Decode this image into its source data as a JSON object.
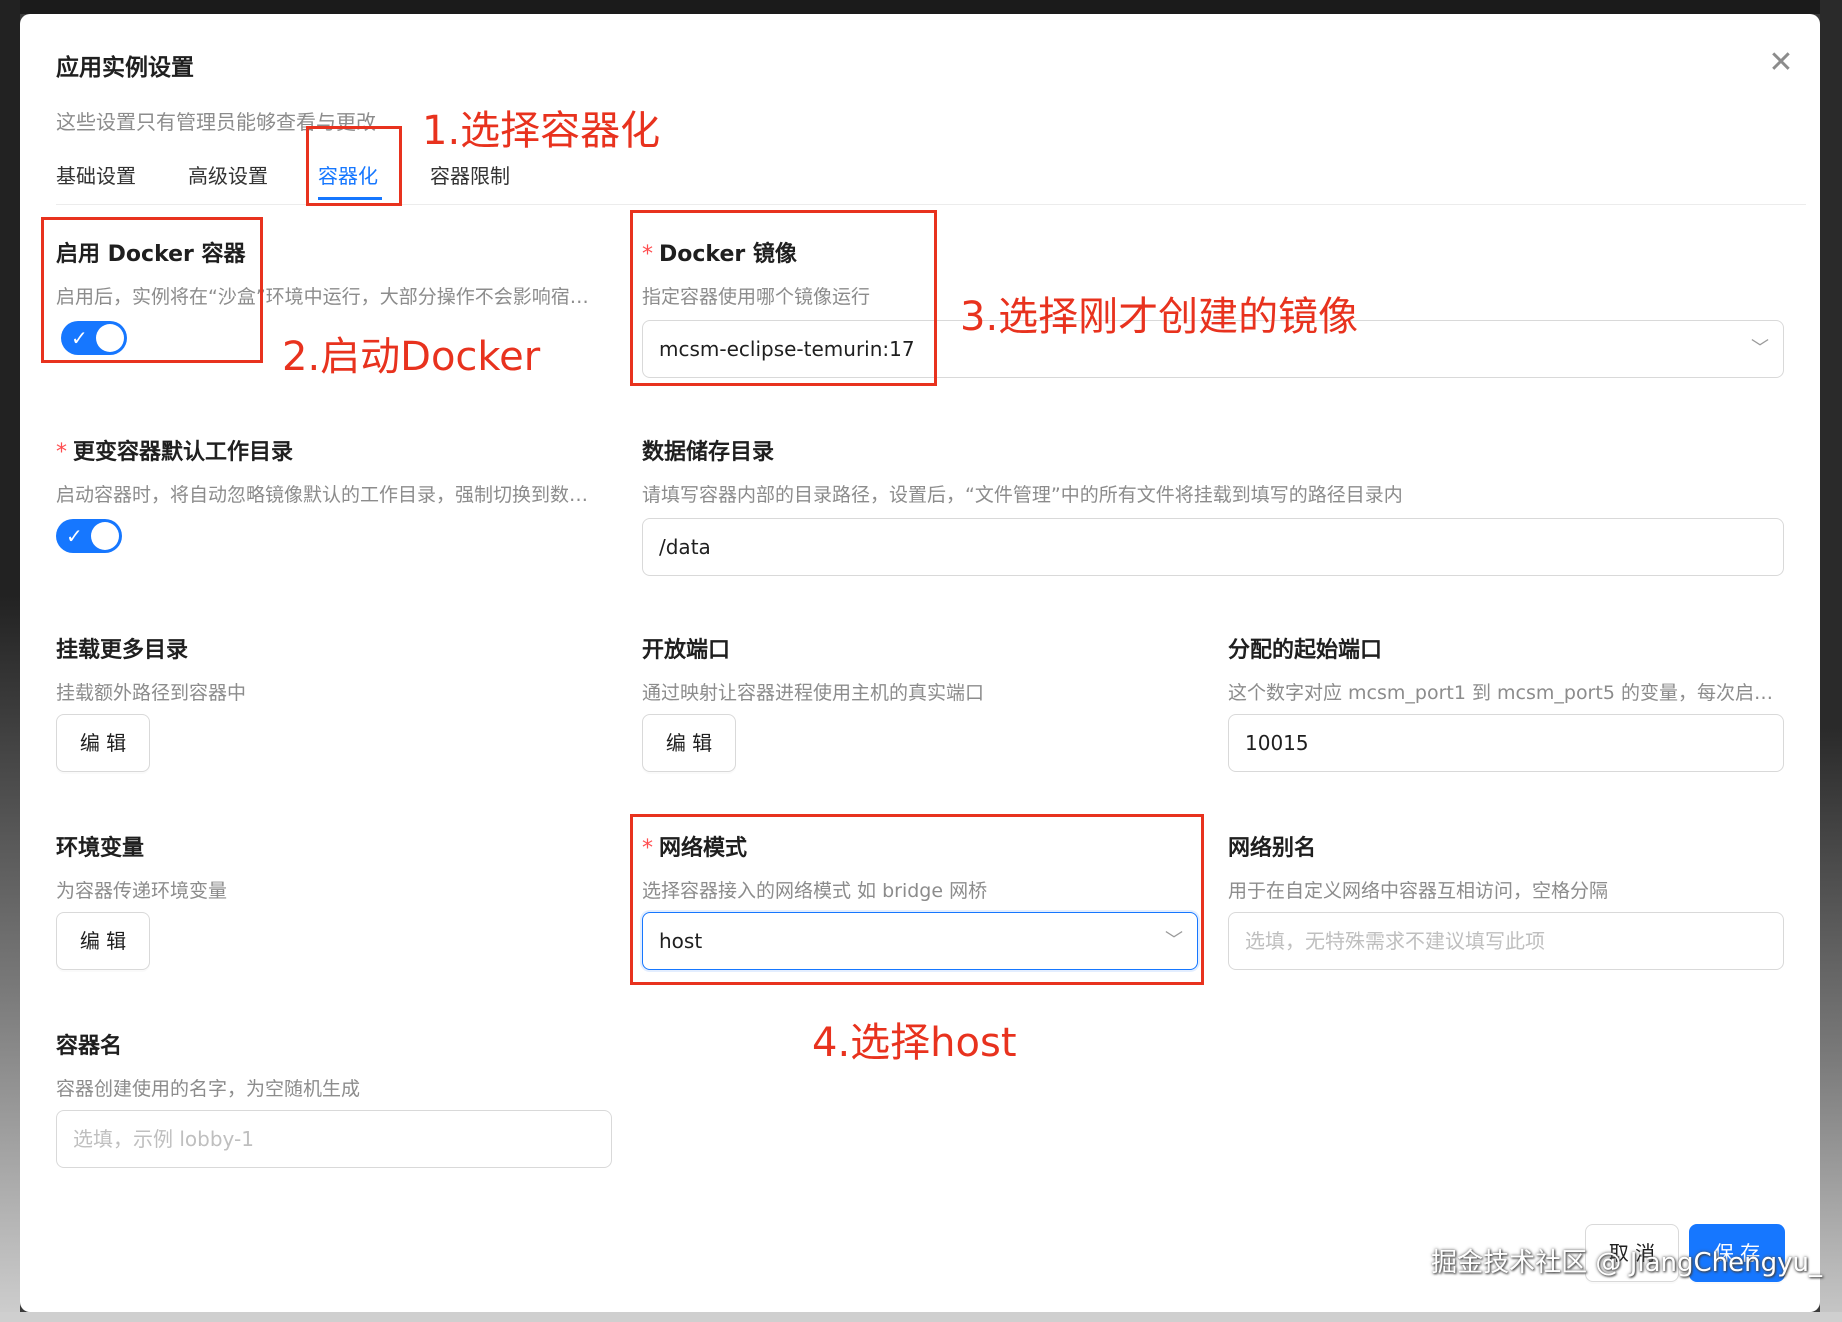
{
  "dialog": {
    "title": "应用实例设置",
    "subtitle": "这些设置只有管理员能够查看与更改",
    "close_icon": "close-icon"
  },
  "tabs": [
    {
      "label": "基础设置"
    },
    {
      "label": "高级设置"
    },
    {
      "label": "容器化",
      "active": true
    },
    {
      "label": "容器限制"
    }
  ],
  "fields": {
    "enable_docker": {
      "label": "启用 Docker 容器",
      "desc": "启用后，实例将在“沙盒”环境中运行，大部分操作不会影响宿主机",
      "enabled": true
    },
    "docker_image": {
      "label": "Docker 镜像",
      "desc": "指定容器使用哪个镜像运行",
      "value": "mcsm-eclipse-temurin:17",
      "required": true
    },
    "change_workdir": {
      "label": "更变容器默认工作目录",
      "desc": "启动容器时，将自动忽略镜像默认的工作目录，强制切换到数据储存目录",
      "enabled": true,
      "required": true
    },
    "data_dir": {
      "label": "数据储存目录",
      "desc": "请填写容器内部的目录路径，设置后，“文件管理”中的所有文件将挂载到填写的路径目录内",
      "value": "/data"
    },
    "mount_dirs": {
      "label": "挂载更多目录",
      "desc": "挂载额外路径到容器中",
      "button": "编 辑"
    },
    "open_ports": {
      "label": "开放端口",
      "desc": "通过映射让容器进程使用主机的真实端口",
      "button": "编 辑"
    },
    "start_port": {
      "label": "分配的起始端口",
      "desc": "这个数字对应 mcsm_port1 到 mcsm_port5 的变量，每次启动时分配",
      "value": "10015"
    },
    "env_vars": {
      "label": "环境变量",
      "desc": "为容器传递环境变量",
      "button": "编 辑"
    },
    "network_mode": {
      "label": "网络模式",
      "desc": "选择容器接入的网络模式 如 bridge 网桥",
      "value": "host",
      "required": true
    },
    "network_alias": {
      "label": "网络别名",
      "desc": "用于在自定义网络中容器互相访问，空格分隔",
      "placeholder": "选填，无特殊需求不建议填写此项"
    },
    "container_name": {
      "label": "容器名",
      "desc": "容器创建使用的名字，为空随机生成",
      "placeholder": "选填，示例 lobby-1"
    }
  },
  "footer": {
    "cancel": "取 消",
    "save": "保 存"
  },
  "annotations": {
    "step1": "1.选择容器化",
    "step2": "2.启动Docker",
    "step3": "3.选择刚才创建的镜像",
    "step4": "4.选择host"
  },
  "watermark": "掘金技术社区 @ JiangChengyu_",
  "colors": {
    "primary": "#1677ff",
    "annotation": "#e8321e",
    "required": "#ff4d4f"
  }
}
